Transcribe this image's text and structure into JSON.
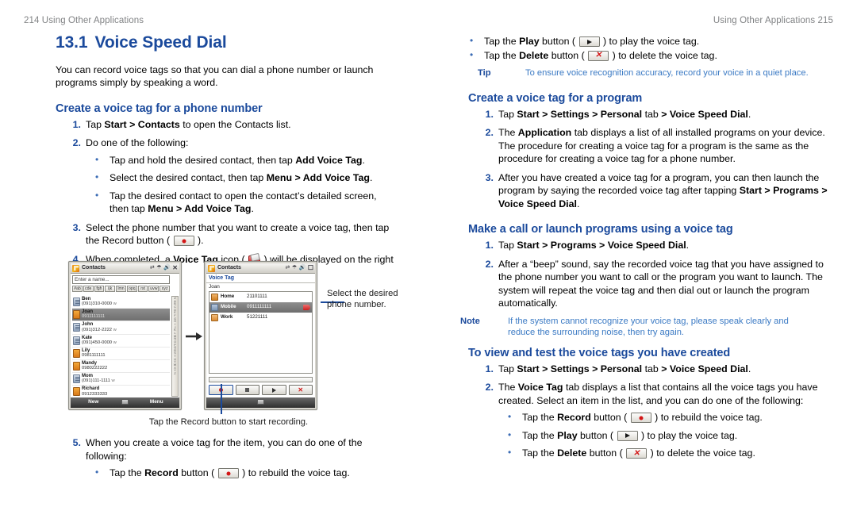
{
  "colors": {
    "heading_blue": "#1b4a9c",
    "callout_blue": "#3b7ac4",
    "runhead_gray": "#808284",
    "record_red": "#d31616"
  },
  "left_page": {
    "running_head": {
      "folio": "214",
      "text": "Using Other Applications"
    },
    "chapter": {
      "number": "13.1",
      "title": "Voice Speed Dial"
    },
    "intro": "You can record voice tags so that you can dial a phone number or launch programs simply by speaking a word.",
    "section_heading": "Create a voice tag for a phone number",
    "steps": [
      {
        "n": "1.",
        "html": "Tap <b>Start &gt; Contacts</b> to open the Contacts list."
      },
      {
        "n": "2.",
        "html": "Do one of the following:",
        "bullets": [
          "Tap and hold the desired contact, then tap <b>Add Voice Tag</b>.",
          "Select the desired contact, then tap <b>Menu &gt; Add Voice Tag</b>.",
          "Tap the desired contact to open the contact’s detailed screen, then tap <b>Menu &gt; Add Voice Tag</b>."
        ]
      },
      {
        "n": "3.",
        "html": "Select the phone number that you want to create a voice tag, then tap the Record button ( <span class=\"btnglyph\" data-name=\"record-button-glyph\"><i class=\"g-rec\"></i></span> )."
      },
      {
        "n": "4.",
        "html": "When completed, a <b>Voice Tag</b> icon ( <span class=\"tagglyph\" data-name=\"voice-tag-icon-glyph\"></span> ) will be displayed on the right of the item."
      }
    ],
    "steps_after": [
      {
        "n": "5.",
        "html": "When you create a voice tag for the item, you can do one of the following:",
        "bullets": [
          "Tap the <b>Record</b> button ( <span class=\"btnglyph\" data-name=\"record-button-glyph\"><i class=\"g-rec\"></i></span> ) to rebuild the voice tag."
        ]
      }
    ],
    "captions": {
      "select_phone": "Select the desired phone number.",
      "tap_record": "Tap the Record button to start recording."
    }
  },
  "screenshot_contacts": {
    "title": "Contacts",
    "search_placeholder": "Enter a name...",
    "alpha_tabs": [
      "#ab",
      "cde",
      "fgh",
      "ijk",
      "lmn",
      "opq",
      "rst",
      "uvw",
      "xyz"
    ],
    "index_letters": "#ABCDEFGHIJKLMNOPQRSTUVWXYZ",
    "contacts": [
      {
        "name": "Ben",
        "number": "(091)310-0000",
        "suffix": "w",
        "icon": "work",
        "selected": false
      },
      {
        "name": "Joan",
        "number": "0911111111",
        "suffix": "m",
        "icon": "mobile",
        "selected": true
      },
      {
        "name": "John",
        "number": "(091)312-2222",
        "suffix": "w",
        "icon": "work",
        "selected": false
      },
      {
        "name": "Kate",
        "number": "(091)450-0000",
        "suffix": "w",
        "icon": "work",
        "selected": false
      },
      {
        "name": "Lily",
        "number": "0981111111",
        "suffix": "",
        "icon": "mobile",
        "selected": false
      },
      {
        "name": "Mandy",
        "number": "0980222222",
        "suffix": "",
        "icon": "mobile",
        "selected": false
      },
      {
        "name": "Mom",
        "number": "(091)111-1111",
        "suffix": "w",
        "icon": "work",
        "selected": false
      },
      {
        "name": "Richard",
        "number": "0912333333",
        "suffix": "",
        "icon": "mobile",
        "selected": false
      }
    ],
    "softkeys": {
      "left": "New",
      "right": "Menu"
    }
  },
  "screenshot_voicetag": {
    "title": "Contacts",
    "tab_label": "Voice Tag",
    "contact_name": "Joan",
    "rows": [
      {
        "label": "Home",
        "number": "21101111",
        "icon": "home",
        "selected": false,
        "has_tag": false
      },
      {
        "label": "Mobile",
        "number": "0911111111",
        "icon": "mobile",
        "selected": true,
        "has_tag": true
      },
      {
        "label": "Work",
        "number": "51221111",
        "icon": "work",
        "selected": false,
        "has_tag": false
      }
    ],
    "buttons": [
      {
        "name": "Record",
        "glyph": "record"
      },
      {
        "name": "Stop",
        "glyph": "stop"
      },
      {
        "name": "Play",
        "glyph": "play"
      },
      {
        "name": "Delete",
        "glyph": "delete"
      }
    ]
  },
  "right_page": {
    "running_head": {
      "folio": "215",
      "text": "Using Other Applications"
    },
    "top_bullets": [
      "Tap the <b>Play</b> button ( <span class=\"btnglyph\" data-name=\"play-button-glyph\"><i class=\"g-play\"></i></span> ) to play the voice tag.",
      "Tap the <b>Delete</b> button ( <span class=\"btnglyph\" data-name=\"delete-button-glyph\"><i class=\"g-del\">✕</i></span> ) to delete the voice tag."
    ],
    "tip": {
      "label": "Tip",
      "text": "To ensure voice recognition accuracy, record your voice in a quiet place."
    },
    "section_program": {
      "heading": "Create a voice tag for a program",
      "steps": [
        {
          "n": "1.",
          "html": "Tap <b>Start &gt; Settings &gt; Personal</b> tab <b>&gt; Voice Speed Dial</b>."
        },
        {
          "n": "2.",
          "html": "The <b>Application</b> tab displays a list of all installed programs on your device. The procedure for creating a voice tag for a program is the same as the procedure for creating a voice tag for a phone number."
        },
        {
          "n": "3.",
          "html": "After you have created a voice tag for a program, you can then launch the program by saying the recorded voice tag after tapping <b>Start &gt; Programs &gt; Voice Speed Dial</b>."
        }
      ]
    },
    "section_call": {
      "heading": "Make a call or launch programs using a voice tag",
      "steps": [
        {
          "n": "1.",
          "html": "Tap <b>Start &gt; Programs &gt; Voice Speed Dial</b>."
        },
        {
          "n": "2.",
          "html": "After a “beep” sound, say the recorded voice tag that you have assigned to the phone number you want to call or the program you want to launch. The system will repeat the voice tag and then dial out or launch the program automatically."
        }
      ],
      "note": {
        "label": "Note",
        "text": "If the system cannot recognize your voice tag, please speak clearly and reduce the surrounding noise, then try again."
      }
    },
    "section_view": {
      "heading": "To view and test the voice tags you have created",
      "steps": [
        {
          "n": "1.",
          "html": "Tap <b>Start &gt; Settings &gt; Personal</b> tab <b>&gt; Voice Speed Dial</b>."
        },
        {
          "n": "2.",
          "html": "The <b>Voice Tag</b> tab displays a list that contains all the voice tags you have created. Select an item in the list, and you can do one of the following:",
          "bullets": [
            "Tap the <b>Record</b> button ( <span class=\"btnglyph\" data-name=\"record-button-glyph\"><i class=\"g-rec\"></i></span> ) to rebuild the voice tag.",
            "Tap the <b>Play</b> button ( <span class=\"btnglyph\" data-name=\"play-button-glyph\"><i class=\"g-play\"></i></span> ) to play the voice tag.",
            "Tap the <b>Delete</b> button ( <span class=\"btnglyph\" data-name=\"delete-button-glyph\"><i class=\"g-del\">✕</i></span> ) to delete the voice tag."
          ]
        }
      ]
    }
  }
}
